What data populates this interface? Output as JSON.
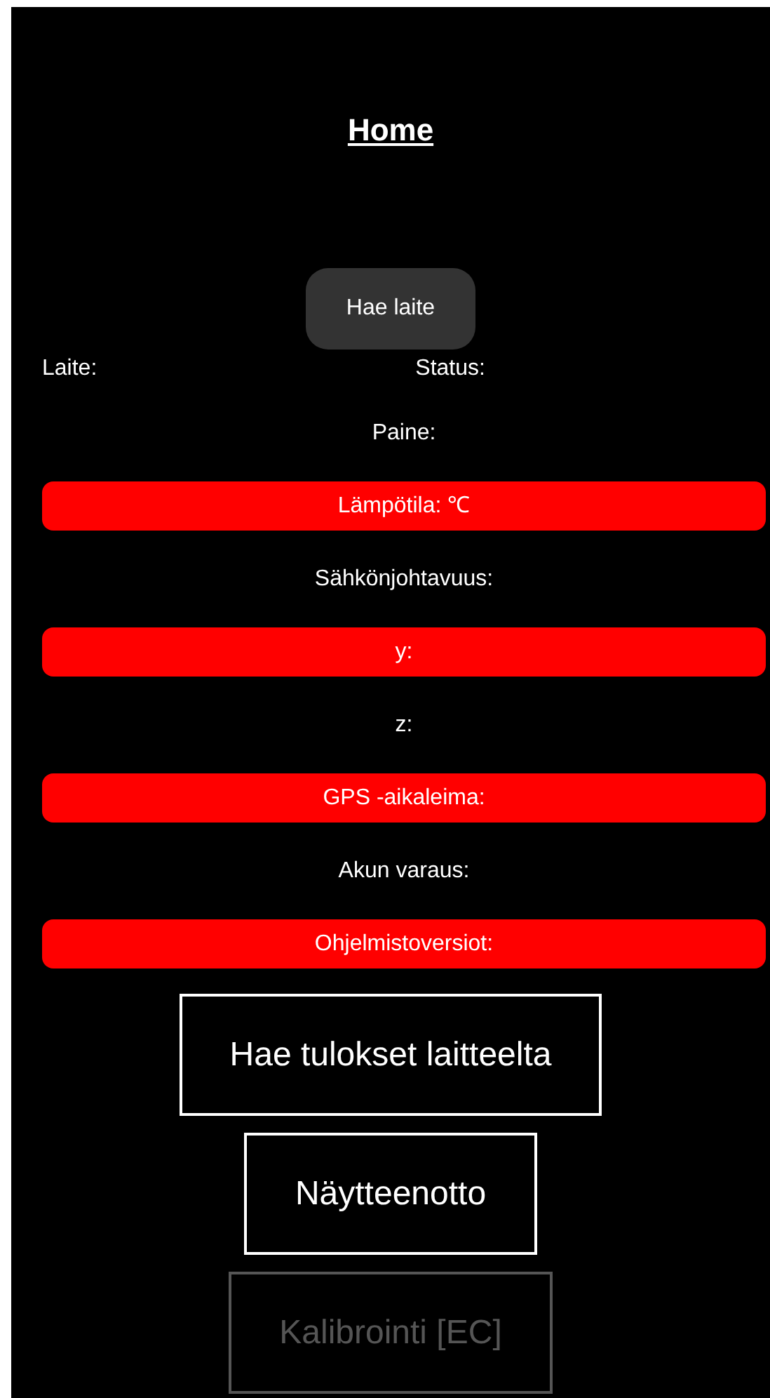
{
  "title": "Home",
  "find_button": "Hae laite",
  "device_label": "Laite:",
  "status_label": "Status:",
  "readings": [
    {
      "label": "Paine:",
      "highlighted": false
    },
    {
      "label": "Lämpötila: ℃",
      "highlighted": true
    },
    {
      "label": "Sähkönjohtavuus:",
      "highlighted": false
    },
    {
      "label": "y:",
      "highlighted": true
    },
    {
      "label": "z:",
      "highlighted": false
    },
    {
      "label": "GPS -aikaleima:",
      "highlighted": true
    },
    {
      "label": "Akun varaus:",
      "highlighted": false
    },
    {
      "label": "Ohjelmistoversiot:",
      "highlighted": true
    }
  ],
  "actions": [
    {
      "label": "Hae tulokset laitteelta",
      "disabled": false
    },
    {
      "label": "Näytteenotto",
      "disabled": false
    },
    {
      "label": "Kalibrointi [EC]",
      "disabled": true
    }
  ]
}
